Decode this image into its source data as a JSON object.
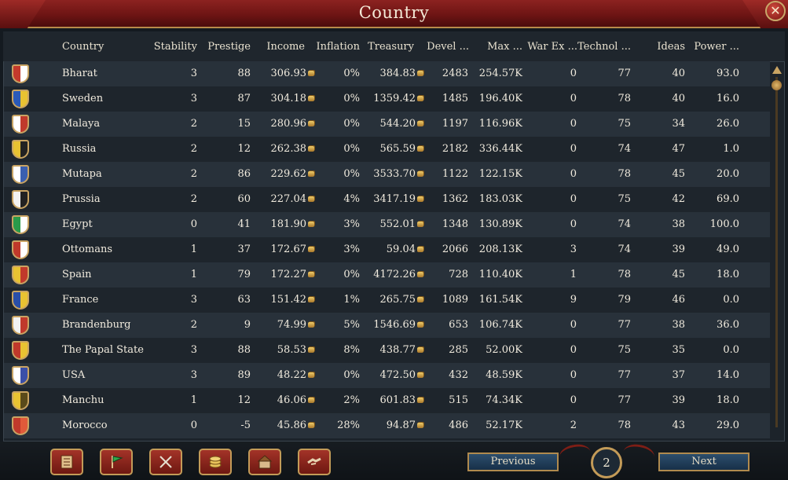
{
  "window": {
    "title": "Country",
    "close_label": "✕"
  },
  "columns": [
    "Country",
    "Stability",
    "Prestige",
    "Income",
    "Inflation",
    "Treasury",
    "Devel ...",
    "Max  ...",
    "War Ex ...",
    "Technol ...",
    "Ideas",
    "Power  ..."
  ],
  "rows": [
    {
      "country": "Bharat",
      "stability": "3",
      "prestige": "88",
      "income": "306.93",
      "inflation": "0%",
      "treasury": "384.83",
      "devel": "2483",
      "max": "254.57K",
      "war": "0",
      "tech": "77",
      "ideas": "40",
      "power": "93.0",
      "colors": [
        "#c43a2c",
        "#ffffff"
      ]
    },
    {
      "country": "Sweden",
      "stability": "3",
      "prestige": "87",
      "income": "304.18",
      "inflation": "0%",
      "treasury": "1359.42",
      "devel": "1485",
      "max": "196.40K",
      "war": "0",
      "tech": "78",
      "ideas": "40",
      "power": "16.0",
      "colors": [
        "#2a5ab8",
        "#e8c232"
      ]
    },
    {
      "country": "Malaya",
      "stability": "2",
      "prestige": "15",
      "income": "280.96",
      "inflation": "0%",
      "treasury": "544.20",
      "devel": "1197",
      "max": "116.96K",
      "war": "0",
      "tech": "75",
      "ideas": "34",
      "power": "26.0",
      "colors": [
        "#ffffff",
        "#c0392b"
      ]
    },
    {
      "country": "Russia",
      "stability": "2",
      "prestige": "12",
      "income": "262.38",
      "inflation": "0%",
      "treasury": "565.59",
      "devel": "2182",
      "max": "336.44K",
      "war": "0",
      "tech": "74",
      "ideas": "47",
      "power": "1.0",
      "colors": [
        "#e8c232",
        "#222222"
      ]
    },
    {
      "country": "Mutapa",
      "stability": "2",
      "prestige": "86",
      "income": "229.62",
      "inflation": "0%",
      "treasury": "3533.70",
      "devel": "1122",
      "max": "122.15K",
      "war": "0",
      "tech": "78",
      "ideas": "45",
      "power": "20.0",
      "colors": [
        "#ffffff",
        "#3a5fb0"
      ]
    },
    {
      "country": "Prussia",
      "stability": "2",
      "prestige": "60",
      "income": "227.04",
      "inflation": "4%",
      "treasury": "3417.19",
      "devel": "1362",
      "max": "183.03K",
      "war": "0",
      "tech": "75",
      "ideas": "42",
      "power": "69.0",
      "colors": [
        "#f2f2f2",
        "#222222"
      ]
    },
    {
      "country": "Egypt",
      "stability": "0",
      "prestige": "41",
      "income": "181.90",
      "inflation": "3%",
      "treasury": "552.01",
      "devel": "1348",
      "max": "130.89K",
      "war": "0",
      "tech": "74",
      "ideas": "38",
      "power": "100.0",
      "colors": [
        "#2a9a4a",
        "#ffffff"
      ]
    },
    {
      "country": "Ottomans",
      "stability": "1",
      "prestige": "37",
      "income": "172.67",
      "inflation": "3%",
      "treasury": "59.04",
      "devel": "2066",
      "max": "208.13K",
      "war": "3",
      "tech": "74",
      "ideas": "39",
      "power": "49.0",
      "colors": [
        "#c0392b",
        "#ffffff"
      ]
    },
    {
      "country": "Spain",
      "stability": "1",
      "prestige": "79",
      "income": "172.27",
      "inflation": "0%",
      "treasury": "4172.26",
      "devel": "728",
      "max": "110.40K",
      "war": "1",
      "tech": "78",
      "ideas": "45",
      "power": "18.0",
      "colors": [
        "#e8c232",
        "#c0392b"
      ]
    },
    {
      "country": "France",
      "stability": "3",
      "prestige": "63",
      "income": "151.42",
      "inflation": "1%",
      "treasury": "265.75",
      "devel": "1089",
      "max": "161.54K",
      "war": "9",
      "tech": "79",
      "ideas": "46",
      "power": "0.0",
      "colors": [
        "#2a4fa8",
        "#e8c232"
      ]
    },
    {
      "country": "Brandenburg",
      "stability": "2",
      "prestige": "9",
      "income": "74.99",
      "inflation": "5%",
      "treasury": "1546.69",
      "devel": "653",
      "max": "106.74K",
      "war": "0",
      "tech": "77",
      "ideas": "38",
      "power": "36.0",
      "colors": [
        "#f2f2f2",
        "#c0392b"
      ]
    },
    {
      "country": "The Papal State",
      "stability": "3",
      "prestige": "88",
      "income": "58.53",
      "inflation": "8%",
      "treasury": "438.77",
      "devel": "285",
      "max": "52.00K",
      "war": "0",
      "tech": "75",
      "ideas": "35",
      "power": "0.0",
      "colors": [
        "#c0392b",
        "#e8c232"
      ]
    },
    {
      "country": "USA",
      "stability": "3",
      "prestige": "89",
      "income": "48.22",
      "inflation": "0%",
      "treasury": "472.50",
      "devel": "432",
      "max": "48.59K",
      "war": "0",
      "tech": "77",
      "ideas": "37",
      "power": "14.0",
      "colors": [
        "#ffffff",
        "#3a4fa8"
      ]
    },
    {
      "country": "Manchu",
      "stability": "1",
      "prestige": "12",
      "income": "46.06",
      "inflation": "2%",
      "treasury": "601.83",
      "devel": "515",
      "max": "74.34K",
      "war": "0",
      "tech": "77",
      "ideas": "39",
      "power": "18.0",
      "colors": [
        "#e8c232",
        "#5a4a1a"
      ]
    },
    {
      "country": "Morocco",
      "stability": "0",
      "prestige": "-5",
      "income": "45.86",
      "inflation": "28%",
      "treasury": "94.87",
      "devel": "486",
      "max": "52.17K",
      "war": "2",
      "tech": "78",
      "ideas": "43",
      "power": "29.0",
      "colors": [
        "#c0392b",
        "#e05a3a"
      ]
    }
  ],
  "footer": {
    "buttons": [
      "ledger-icon",
      "flag-icon",
      "crossed-swords-icon",
      "coins-icon",
      "buildings-icon",
      "handshake-icon"
    ],
    "previous_label": "Previous",
    "next_label": "Next",
    "page": "2"
  }
}
